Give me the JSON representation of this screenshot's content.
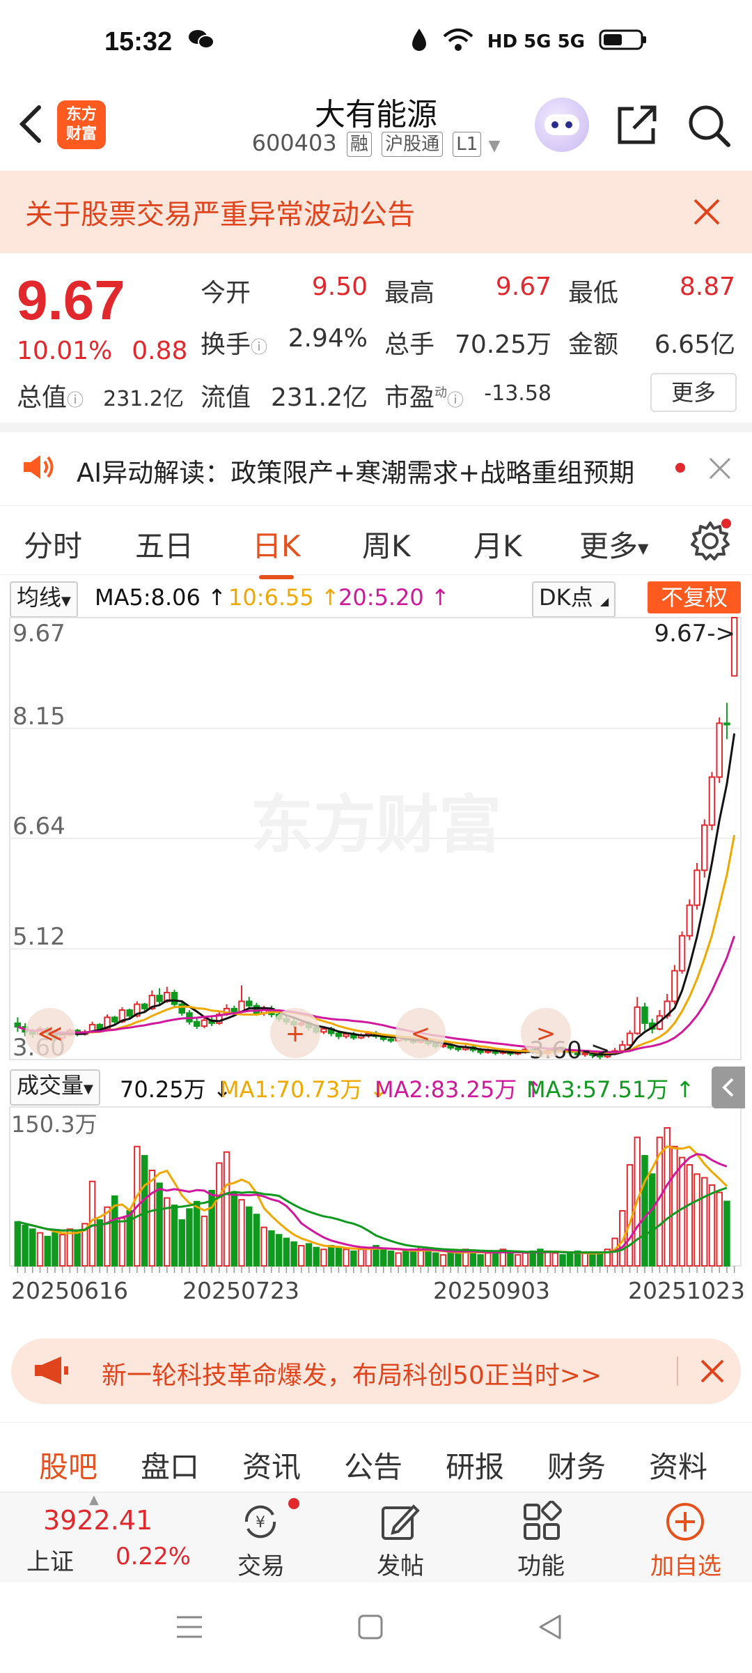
{
  "status": {
    "time": "15:32",
    "network": "HD 5G 5G"
  },
  "header": {
    "logo_line1": "东方",
    "logo_line2": "财富",
    "title": "大有能源",
    "code": "600403",
    "tags": [
      "融",
      "沪股通",
      "L1"
    ]
  },
  "notice": {
    "text": "关于股票交易严重异常波动公告"
  },
  "quote": {
    "price": "9.67",
    "change_pct": "10.01%",
    "change_amt": "0.88",
    "open_label": "今开",
    "open": "9.50",
    "high_label": "最高",
    "high": "9.67",
    "low_label": "最低",
    "low": "8.87",
    "turnover_label": "换手",
    "turnover": "2.94%",
    "volume_label": "总手",
    "volume": "70.25万",
    "amount_label": "金额",
    "amount": "6.65亿",
    "mcap_label": "总值",
    "mcap": "231.2亿",
    "float_label": "流值",
    "float_val": "231.2亿",
    "pe_label": "市盈",
    "pe_sup": "动",
    "pe": "-13.58",
    "more": "更多"
  },
  "ai": {
    "text": "AI异动解读：政策限产+寒潮需求+战略重组预期"
  },
  "ktabs": [
    "分时",
    "五日",
    "日K",
    "周K",
    "月K",
    "更多"
  ],
  "ma": {
    "select": "均线",
    "ma5": "MA5:8.06",
    "ma10": "10:6.55",
    "ma20": "20:5.20",
    "dk": "DK点",
    "fq": "不复权",
    "colors": {
      "ma5": "#111111",
      "ma10": "#f0a800",
      "ma20": "#d0189c",
      "up": "#e0282d",
      "down": "#0f9a1f"
    }
  },
  "watermark": "东方财富",
  "vol": {
    "select": "成交量",
    "value": "70.25万",
    "ma1": "MA1:70.73万",
    "ma2": "MA2:83.25万",
    "ma3": "MA3:57.51万"
  },
  "chart_data": {
    "type": "candlestick",
    "y_ticks": [
      "9.67",
      "8.15",
      "6.64",
      "5.12",
      "3.60"
    ],
    "ylim": [
      3.6,
      9.67
    ],
    "max_label": "9.67->",
    "min_label": "3.60->",
    "vol_max_label": "150.3万",
    "x_ticks": [
      "20250616",
      "20250723",
      "20250903",
      "20251023"
    ],
    "candles": [
      [
        4.1,
        4.05,
        4.18,
        3.98
      ],
      [
        4.05,
        3.98,
        4.1,
        3.92
      ],
      [
        3.98,
        3.95,
        4.02,
        3.9
      ],
      [
        3.95,
        4.02,
        4.06,
        3.93
      ],
      [
        4.02,
        3.96,
        4.05,
        3.92
      ],
      [
        3.96,
        3.9,
        3.99,
        3.86
      ],
      [
        3.9,
        3.94,
        3.97,
        3.87
      ],
      [
        3.94,
        4.0,
        4.03,
        3.92
      ],
      [
        4.0,
        3.95,
        4.02,
        3.92
      ],
      [
        3.95,
        3.98,
        4.01,
        3.93
      ],
      [
        3.98,
        4.08,
        4.12,
        3.96
      ],
      [
        4.08,
        4.02,
        4.1,
        3.99
      ],
      [
        4.02,
        4.18,
        4.22,
        4.0
      ],
      [
        4.18,
        4.12,
        4.2,
        4.08
      ],
      [
        4.12,
        4.28,
        4.32,
        4.1
      ],
      [
        4.28,
        4.2,
        4.3,
        4.16
      ],
      [
        4.2,
        4.36,
        4.4,
        4.18
      ],
      [
        4.36,
        4.3,
        4.38,
        4.25
      ],
      [
        4.3,
        4.48,
        4.55,
        4.28
      ],
      [
        4.48,
        4.4,
        4.58,
        4.36
      ],
      [
        4.4,
        4.52,
        4.6,
        4.38
      ],
      [
        4.52,
        4.36,
        4.56,
        4.32
      ],
      [
        4.36,
        4.24,
        4.4,
        4.2
      ],
      [
        4.24,
        4.12,
        4.28,
        4.08
      ],
      [
        4.12,
        4.06,
        4.16,
        4.02
      ],
      [
        4.06,
        4.14,
        4.18,
        4.03
      ],
      [
        4.14,
        4.1,
        4.18,
        4.06
      ],
      [
        4.1,
        4.22,
        4.26,
        4.08
      ],
      [
        4.22,
        4.3,
        4.36,
        4.2
      ],
      [
        4.3,
        4.26,
        4.34,
        4.22
      ],
      [
        4.26,
        4.4,
        4.62,
        4.24
      ],
      [
        4.4,
        4.34,
        4.46,
        4.3
      ],
      [
        4.34,
        4.24,
        4.38,
        4.2
      ],
      [
        4.24,
        4.3,
        4.34,
        4.2
      ],
      [
        4.3,
        4.22,
        4.34,
        4.18
      ],
      [
        4.22,
        4.16,
        4.26,
        4.12
      ],
      [
        4.16,
        4.12,
        4.2,
        4.08
      ],
      [
        4.12,
        4.08,
        4.16,
        4.04
      ],
      [
        4.08,
        4.1,
        4.14,
        4.05
      ],
      [
        4.1,
        4.04,
        4.13,
        4.0
      ],
      [
        4.04,
        3.98,
        4.08,
        3.95
      ],
      [
        3.98,
        4.02,
        4.06,
        3.95
      ],
      [
        4.02,
        3.96,
        4.05,
        3.92
      ],
      [
        3.96,
        3.92,
        3.99,
        3.88
      ],
      [
        3.92,
        3.95,
        3.98,
        3.89
      ],
      [
        3.95,
        3.9,
        3.98,
        3.87
      ],
      [
        3.9,
        3.93,
        3.96,
        3.88
      ],
      [
        3.93,
        3.96,
        3.99,
        3.9
      ],
      [
        3.96,
        3.92,
        3.99,
        3.89
      ],
      [
        3.92,
        3.88,
        3.95,
        3.85
      ],
      [
        3.88,
        3.86,
        3.92,
        3.83
      ],
      [
        3.86,
        3.9,
        3.93,
        3.84
      ],
      [
        3.9,
        3.87,
        3.92,
        3.84
      ],
      [
        3.87,
        3.84,
        3.9,
        3.81
      ],
      [
        3.84,
        3.88,
        3.91,
        3.82
      ],
      [
        3.88,
        3.82,
        3.9,
        3.79
      ],
      [
        3.82,
        3.78,
        3.85,
        3.75
      ],
      [
        3.78,
        3.8,
        3.83,
        3.76
      ],
      [
        3.8,
        3.76,
        3.82,
        3.73
      ],
      [
        3.76,
        3.74,
        3.79,
        3.71
      ],
      [
        3.74,
        3.77,
        3.8,
        3.72
      ],
      [
        3.77,
        3.73,
        3.79,
        3.7
      ],
      [
        3.73,
        3.7,
        3.76,
        3.67
      ],
      [
        3.7,
        3.72,
        3.75,
        3.68
      ],
      [
        3.72,
        3.69,
        3.74,
        3.66
      ],
      [
        3.69,
        3.71,
        3.74,
        3.67
      ],
      [
        3.71,
        3.68,
        3.73,
        3.65
      ],
      [
        3.68,
        3.7,
        3.73,
        3.66
      ],
      [
        3.7,
        3.74,
        3.77,
        3.68
      ],
      [
        3.74,
        3.71,
        3.76,
        3.68
      ],
      [
        3.71,
        3.69,
        3.74,
        3.66
      ],
      [
        3.69,
        3.72,
        3.75,
        3.67
      ],
      [
        3.72,
        3.76,
        3.79,
        3.7
      ],
      [
        3.76,
        3.73,
        3.78,
        3.7
      ],
      [
        3.73,
        3.7,
        3.75,
        3.67
      ],
      [
        3.7,
        3.67,
        3.72,
        3.64
      ],
      [
        3.67,
        3.69,
        3.72,
        3.64
      ],
      [
        3.69,
        3.66,
        3.71,
        3.62
      ],
      [
        3.66,
        3.64,
        3.68,
        3.6
      ],
      [
        3.64,
        3.68,
        3.71,
        3.62
      ],
      [
        3.68,
        3.72,
        3.76,
        3.66
      ],
      [
        3.72,
        3.8,
        3.86,
        3.7
      ],
      [
        3.8,
        3.96,
        4.0,
        3.78
      ],
      [
        3.96,
        4.32,
        4.46,
        3.94
      ],
      [
        4.32,
        4.1,
        4.38,
        4.0
      ],
      [
        4.1,
        4.02,
        4.16,
        3.96
      ],
      [
        4.02,
        4.2,
        4.28,
        4.0
      ],
      [
        4.2,
        4.4,
        4.5,
        4.16
      ],
      [
        4.4,
        4.82,
        4.9,
        4.36
      ],
      [
        4.82,
        5.3,
        5.36,
        4.78
      ],
      [
        5.3,
        5.72,
        5.8,
        5.24
      ],
      [
        5.72,
        6.2,
        6.3,
        5.66
      ],
      [
        6.2,
        6.82,
        6.9,
        6.1
      ],
      [
        6.82,
        7.48,
        7.55,
        6.75
      ],
      [
        7.48,
        8.22,
        8.3,
        7.4
      ],
      [
        8.22,
        8.2,
        8.5,
        8.0
      ],
      [
        8.87,
        9.67,
        9.67,
        8.87
      ]
    ],
    "volumes": [
      48,
      44,
      40,
      36,
      32,
      36,
      34,
      40,
      38,
      46,
      92,
      50,
      64,
      76,
      52,
      60,
      130,
      120,
      104,
      90,
      74,
      66,
      50,
      62,
      70,
      54,
      82,
      112,
      124,
      80,
      72,
      64,
      56,
      42,
      38,
      34,
      30,
      26,
      22,
      24,
      20,
      18,
      22,
      20,
      18,
      16,
      18,
      20,
      22,
      18,
      16,
      14,
      16,
      18,
      20,
      16,
      14,
      12,
      14,
      16,
      18,
      14,
      12,
      14,
      16,
      18,
      14,
      12,
      14,
      16,
      18,
      16,
      14,
      12,
      14,
      16,
      14,
      12,
      14,
      18,
      30,
      60,
      110,
      140,
      120,
      100,
      140,
      150.3,
      130,
      118,
      110,
      100,
      96,
      88,
      80,
      70.25
    ],
    "ma5_label": "MA5:8.06",
    "ma10_label": "10:6.55",
    "ma20_label": "20:5.20"
  },
  "promo": {
    "text": "新一轮科技革命爆发，布局科创50正当时>>"
  },
  "btabs": [
    "股吧",
    "盘口",
    "资讯",
    "公告",
    "研报",
    "财务",
    "资料"
  ],
  "toolbar": {
    "index_value": "3922.41",
    "index_name": "上证",
    "index_change": "0.22%",
    "trade": "交易",
    "post": "发帖",
    "features": "功能",
    "add": "加自选"
  }
}
